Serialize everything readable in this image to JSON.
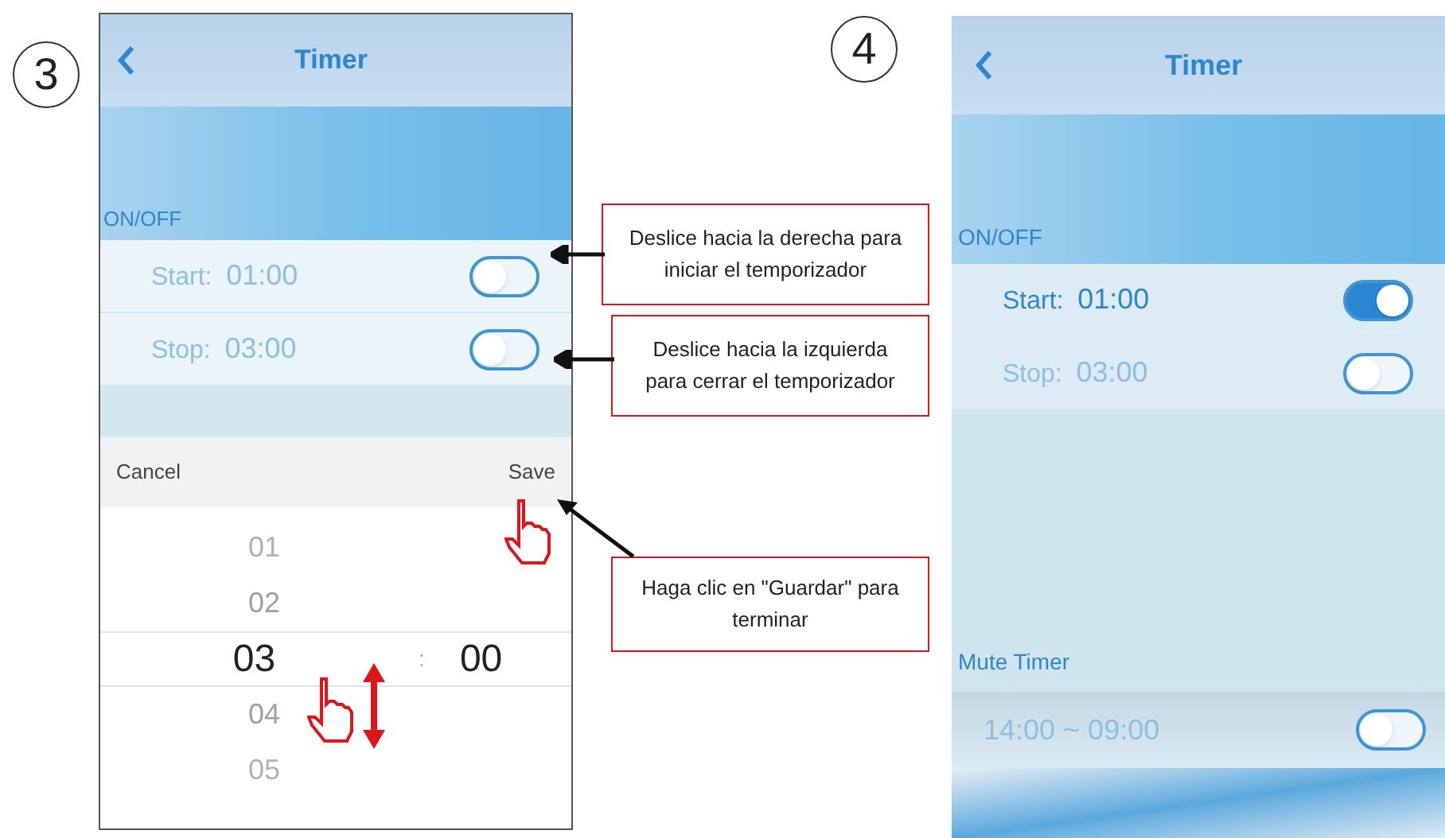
{
  "screen_3": {
    "step": "3",
    "title": "Timer",
    "section": "ON/OFF",
    "rows": [
      {
        "label": "Start:",
        "time": "01:00",
        "on": false
      },
      {
        "label": "Stop:",
        "time": "03:00",
        "on": false
      }
    ],
    "picker": {
      "cancel": "Cancel",
      "save": "Save",
      "separator": ":",
      "minutes": "00",
      "hours": [
        {
          "value": "01",
          "selected": false
        },
        {
          "value": "02",
          "selected": false
        },
        {
          "value": "03",
          "selected": true
        },
        {
          "value": "04",
          "selected": false
        },
        {
          "value": "05",
          "selected": false
        }
      ]
    }
  },
  "callouts": [
    "Deslice hacia la derecha para iniciar el temporizador",
    "Deslice hacia la izquierda para cerrar el temporizador",
    "Haga clic en \"Guardar\" para terminar"
  ],
  "screen_4": {
    "step": "4",
    "title": "Timer",
    "section": "ON/OFF",
    "rows": [
      {
        "label": "Start:",
        "time": "01:00",
        "on": true
      },
      {
        "label": "Stop:",
        "time": "03:00",
        "on": false
      }
    ],
    "mute_section": "Mute Timer",
    "mute_rows": [
      {
        "time": "14:00 ~ 09:00",
        "on": false
      }
    ]
  }
}
